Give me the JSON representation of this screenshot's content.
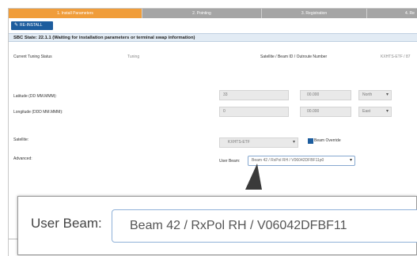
{
  "wizard": {
    "steps": [
      "1. Install Parameters",
      "2. Pointing",
      "3. Registration",
      "4. Re"
    ]
  },
  "toolbar": {
    "reinstall_icon": "wrench-icon",
    "reinstall_label": "RE-INSTALL"
  },
  "state_line": "SBC State: 22.1.1 (Waiting for installation parameters or terminal swap information)",
  "status": {
    "current_tuning_label": "Current Tuning Status",
    "current_tuning_value": "Tuning",
    "satellite_beam_label": "Satellite / Beam ID / Outroute Number",
    "satellite_beam_value": "KXHTS-ETF / 87"
  },
  "latitude": {
    "label": "Latitude (DD MM.MMM):",
    "degrees": "33",
    "minutes": "00.000",
    "direction": "North"
  },
  "longitude": {
    "label": "Longitude (DDD MM.MMM):",
    "degrees": "0",
    "minutes": "00.000",
    "direction": "East"
  },
  "satellite": {
    "label": "Satellite:",
    "value": "KXHTS-ETF",
    "override_label": "Beam Override",
    "override_checked": true
  },
  "advanced": {
    "label": "Advanced:",
    "user_beam_label": "User Beam:",
    "user_beam_value": "Beam 42 / RxPol RH / V06042DFBF11p0"
  },
  "zoom": {
    "label": "User Beam:",
    "value": "Beam 42 / RxPol RH / V06042DFBF11"
  },
  "colors": {
    "accent": "#f09d3a",
    "primary": "#1d5d9e",
    "state_bg": "#e2ebf4"
  }
}
